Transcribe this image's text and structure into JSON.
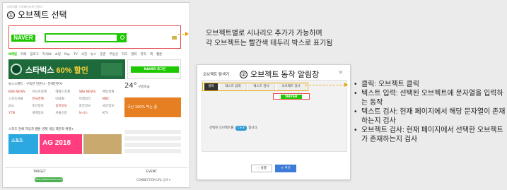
{
  "step1": {
    "number": "①",
    "label": "오브젝트 선택"
  },
  "left_topline": "네이버를 시작페이지로 만들기",
  "naver_logo": "NAVER",
  "nav_items": [
    "N메일",
    "카페",
    "블로그",
    "지식iN",
    "쇼핑",
    "Pay",
    "TV",
    "사전",
    "뉴스",
    "증권",
    "부동산",
    "지도",
    "영화",
    "뮤직",
    "책",
    "웹툰"
  ],
  "banner": {
    "text": "스타벅스 ",
    "pct": "60% 할인"
  },
  "login_label": "NAVER 로그인",
  "shop_tabs": "뉴스스탠드 · 구독한 언론사 · 전체언론사",
  "shop_items": [
    "KBS NEWS",
    "아시아경제",
    "헤럴드경제",
    "SBS NEWS",
    "매일경제",
    "스포츠서울",
    "한국경제",
    "OSEN",
    "이데일리",
    "MBC",
    "jtbc",
    "조선일보",
    "동아일보",
    "중앙일보",
    "국민일보",
    "YTN",
    "세계일보",
    "서울신문",
    "뉴시스",
    "KTV"
  ],
  "weather": {
    "deg": "24°",
    "desc": "구름조금"
  },
  "right_ad": "국산 100% 먹는 꿀",
  "bottom_tabs": "스포츠  연예  자동차  웹툰  경제  게임  책문화  여행+",
  "thumb1": "스포츠",
  "thumb2": "AG 2018",
  "grid": {
    "target_header": "TARGET",
    "event_header": "EVENT",
    "url_pill": "http://www.naver.com",
    "connection": "CONNECTION URL 검색 ▾"
  },
  "annotation1": {
    "line1": "오브젝트별로 시나리오 추가가 가능하며",
    "line2": "각 오브젝트는 빨간색 테두리 박스로 표기됨"
  },
  "dialog": {
    "title": "오브젝트 탐색기",
    "close": "×",
    "tabs": [
      "클릭",
      "텍스트 입력",
      "텍스트 검사",
      "오브젝트 검사"
    ],
    "naver_preview": "NAVER",
    "selected_prefix": "선택된 오브젝트를",
    "click_badge": "Click",
    "selected_suffix": "합니다.",
    "cancel_label": "◌ 실행",
    "add_label": "+ 추가"
  },
  "step2": {
    "number": "②",
    "label": "오브젝트 동작 알림창"
  },
  "annotation2": {
    "items": [
      "클릭: 오브젝트 클릭",
      "텍스트 입력: 선택된 오브젝트에 문자열을 입력하는 동작",
      "텍스트 검사: 현재 페이지에서 해당 문자열이 존재하는지 검사",
      "오브젝트 검사: 현재 페이지에서 선택한 오브젝트가 존재하는지 검사"
    ]
  },
  "colors": {
    "naver_green": "#1ec800",
    "object_border": "#e64a4a",
    "annotation_arrow": "#e7a000",
    "click_badge": "#2b98d4",
    "add_button": "#3d7bd8"
  }
}
